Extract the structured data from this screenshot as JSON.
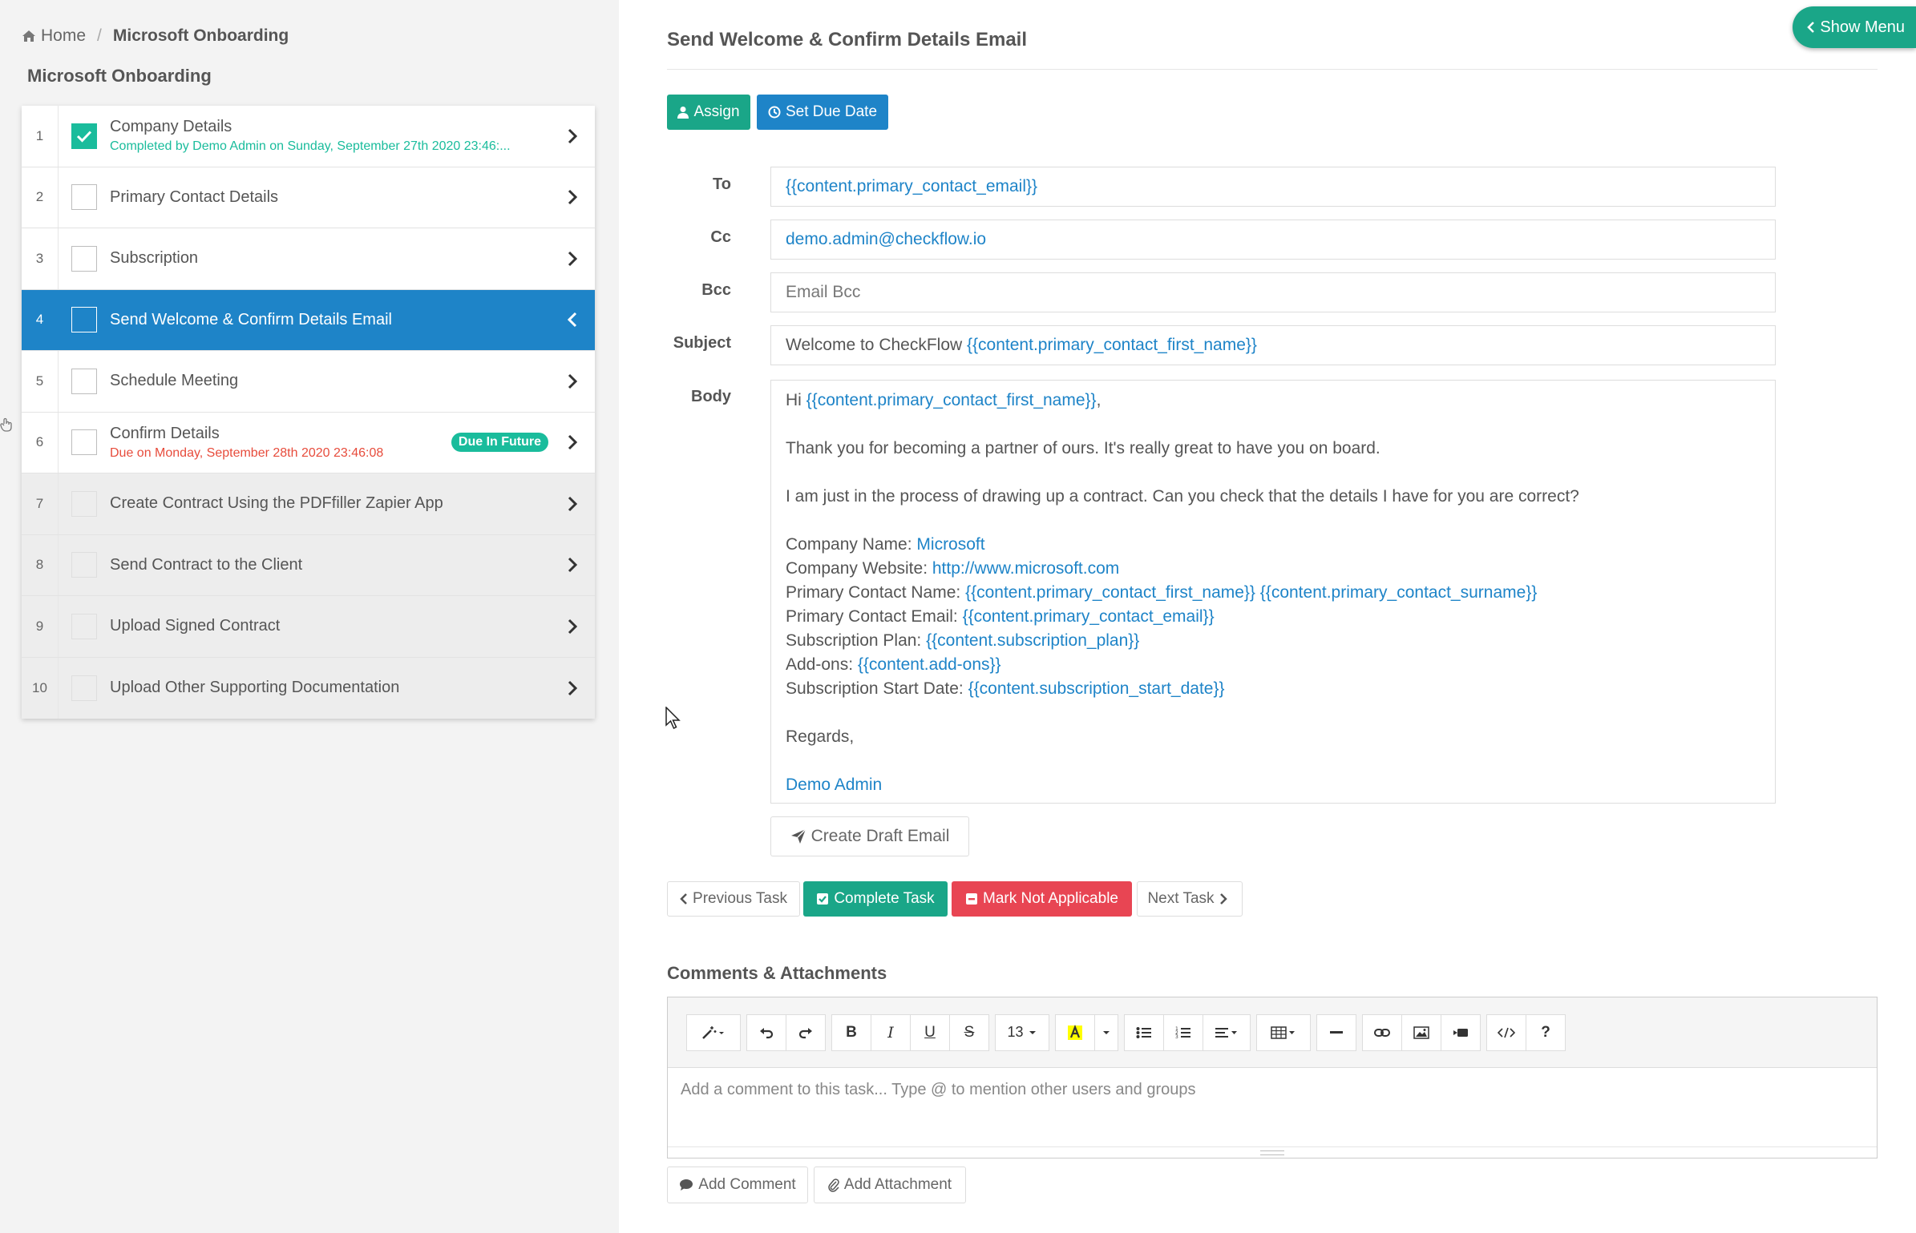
{
  "breadcrumb": {
    "home": "Home",
    "current": "Microsoft Onboarding"
  },
  "checklist": {
    "title": "Microsoft Onboarding",
    "tasks": [
      {
        "num": "1",
        "title": "Company Details",
        "sub": "Completed by Demo Admin on Sunday, September 27th 2020 23:46:...",
        "state": "completed"
      },
      {
        "num": "2",
        "title": "Primary Contact Details",
        "state": "open"
      },
      {
        "num": "3",
        "title": "Subscription",
        "state": "open"
      },
      {
        "num": "4",
        "title": "Send Welcome & Confirm Details Email",
        "state": "active"
      },
      {
        "num": "5",
        "title": "Schedule Meeting",
        "state": "open"
      },
      {
        "num": "6",
        "title": "Confirm Details",
        "sub": "Due on Monday, September 28th 2020 23:46:08",
        "badge": "Due In Future",
        "state": "due"
      },
      {
        "num": "7",
        "title": "Create Contract Using the PDFfiller Zapier App",
        "state": "locked"
      },
      {
        "num": "8",
        "title": "Send Contract to the Client",
        "state": "locked"
      },
      {
        "num": "9",
        "title": "Upload Signed Contract",
        "state": "locked"
      },
      {
        "num": "10",
        "title": "Upload Other Supporting Documentation",
        "state": "locked"
      }
    ]
  },
  "main": {
    "title": "Send Welcome & Confirm Details Email",
    "show_menu": "Show Menu",
    "assign": "Assign",
    "set_due_date": "Set Due Date",
    "labels": {
      "to": "To",
      "cc": "Cc",
      "bcc": "Bcc",
      "subject": "Subject",
      "body": "Body"
    },
    "to_value": "{{content.primary_contact_email}}",
    "cc_value": "demo.admin@checkflow.io",
    "bcc_placeholder": "Email Bcc",
    "subject_text": "Welcome to CheckFlow ",
    "subject_var": "{{content.primary_contact_first_name}}",
    "body": {
      "greeting_prefix": "Hi ",
      "greeting_var": "{{content.primary_contact_first_name}}",
      "greeting_suffix": ",",
      "p1": "Thank you for becoming a partner of ours. It's really great to have you on board.",
      "p2": "I am just in the process of drawing up a contract. Can you check that the details I have for you are correct?",
      "company_name_label": "Company Name: ",
      "company_name_value": "Microsoft",
      "company_website_label": "Company Website: ",
      "company_website_value": "http://www.microsoft.com",
      "contact_name_label": "Primary Contact Name: ",
      "contact_name_first": "{{content.primary_contact_first_name}}",
      "contact_name_surname": "{{content.primary_contact_surname}}",
      "contact_email_label": "Primary Contact Email: ",
      "contact_email_value": "{{content.primary_contact_email}}",
      "plan_label": "Subscription Plan: ",
      "plan_value": "{{content.subscription_plan}}",
      "addons_label": "Add-ons: ",
      "addons_value": "{{content.add-ons}}",
      "start_label": "Subscription Start Date: ",
      "start_value": "{{content.subscription_start_date}}",
      "regards": "Regards,",
      "signature": "Demo Admin"
    },
    "create_draft": "Create Draft Email",
    "previous_task": "Previous Task",
    "complete_task": "Complete Task",
    "mark_na": "Mark Not Applicable",
    "next_task": "Next Task",
    "comments_title": "Comments & Attachments",
    "toolbar": {
      "font_size": "13"
    },
    "comment_placeholder": "Add a comment to this task... Type @ to mention other users and groups",
    "add_comment": "Add Comment",
    "add_attachment": "Add Attachment"
  },
  "colors": {
    "green": "#1aa688",
    "blue": "#1e84c8",
    "red": "#e84553",
    "teal": "#1abc9c"
  }
}
